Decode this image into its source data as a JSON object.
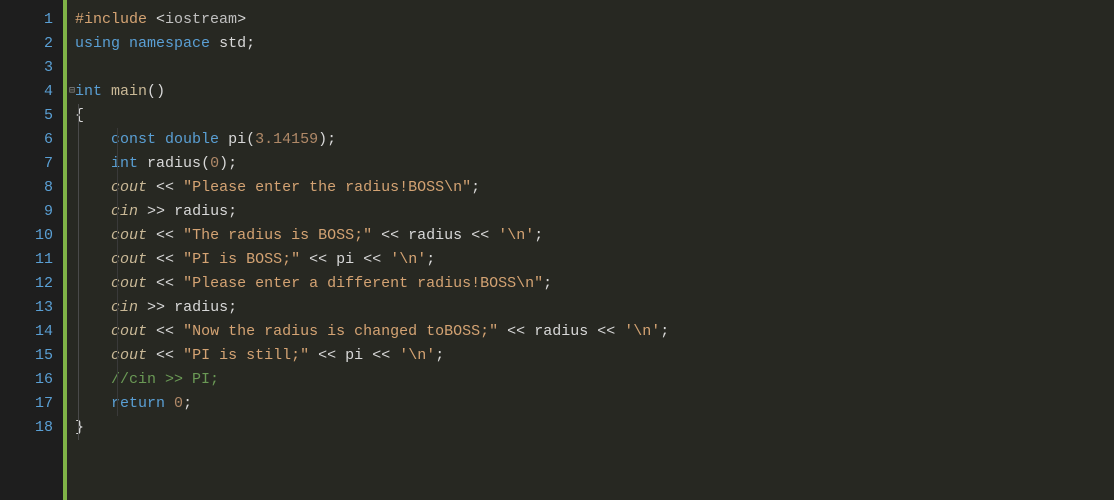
{
  "line_numbers": [
    "1",
    "2",
    "3",
    "4",
    "5",
    "6",
    "7",
    "8",
    "9",
    "10",
    "11",
    "12",
    "13",
    "14",
    "15",
    "16",
    "17",
    "18"
  ],
  "tokens": {
    "l1": {
      "include": "#include",
      "sp1": " ",
      "lt": "<",
      "hdr": "iostream",
      "gt": ">"
    },
    "l2": {
      "using": "using",
      "sp1": " ",
      "namespace": "namespace",
      "sp2": " ",
      "std": "std",
      "semi": ";"
    },
    "l4": {
      "int": "int",
      "sp1": " ",
      "main": "main",
      "lp": "(",
      "rp": ")"
    },
    "l5": {
      "indent": "",
      "brace": "{"
    },
    "l6": {
      "indent": "    ",
      "const": "const",
      "sp1": " ",
      "double": "double",
      "sp2": " ",
      "pi": "pi",
      "lp": "(",
      "val": "3.14159",
      "rp": ")",
      "semi": ";"
    },
    "l7": {
      "indent": "    ",
      "int": "int",
      "sp1": " ",
      "radius": "radius",
      "lp": "(",
      "zero": "0",
      "rp": ")",
      "semi": ";"
    },
    "l8": {
      "indent": "    ",
      "cout": "cout",
      "sp1": " ",
      "op1": "<<",
      "sp2": " ",
      "str": "\"Please enter the radius!BOSS\\n\"",
      "semi": ";"
    },
    "l9": {
      "indent": "    ",
      "cin": "cin",
      "sp1": " ",
      "op1": ">>",
      "sp2": " ",
      "radius": "radius",
      "semi": ";"
    },
    "l10": {
      "indent": "    ",
      "cout": "cout",
      "sp1": " ",
      "op1": "<<",
      "sp2": " ",
      "str": "\"The radius is BOSS;\"",
      "sp3": " ",
      "op2": "<<",
      "sp4": " ",
      "radius": "radius",
      "sp5": " ",
      "op3": "<<",
      "sp6": " ",
      "ch": "'\\n'",
      "semi": ";"
    },
    "l11": {
      "indent": "    ",
      "cout": "cout",
      "sp1": " ",
      "op1": "<<",
      "sp2": " ",
      "str": "\"PI is BOSS;\"",
      "sp3": " ",
      "op2": "<<",
      "sp4": " ",
      "pi": "pi",
      "sp5": " ",
      "op3": "<<",
      "sp6": " ",
      "ch": "'\\n'",
      "semi": ";"
    },
    "l12": {
      "indent": "    ",
      "cout": "cout",
      "sp1": " ",
      "op1": "<<",
      "sp2": " ",
      "str": "\"Please enter a different radius!BOSS\\n\"",
      "semi": ";"
    },
    "l13": {
      "indent": "    ",
      "cin": "cin",
      "sp1": " ",
      "op1": ">>",
      "sp2": " ",
      "radius": "radius",
      "semi": ";"
    },
    "l14": {
      "indent": "    ",
      "cout": "cout",
      "sp1": " ",
      "op1": "<<",
      "sp2": " ",
      "str": "\"Now the radius is changed toBOSS;\"",
      "sp3": " ",
      "op2": "<<",
      "sp4": " ",
      "radius": "radius",
      "sp5": " ",
      "op3": "<<",
      "sp6": " ",
      "ch": "'\\n'",
      "semi": ";"
    },
    "l15": {
      "indent": "    ",
      "cout": "cout",
      "sp1": " ",
      "op1": "<<",
      "sp2": " ",
      "str": "\"PI is still;\"",
      "sp3": " ",
      "op2": "<<",
      "sp4": " ",
      "pi": "pi",
      "sp5": " ",
      "op3": "<<",
      "sp6": " ",
      "ch": "'\\n'",
      "semi": ";"
    },
    "l16": {
      "indent": "    ",
      "comment": "//cin >> PI;"
    },
    "l17": {
      "indent": "    ",
      "return": "return",
      "sp1": " ",
      "zero": "0",
      "semi": ";"
    },
    "l18": {
      "indent": "",
      "brace": "}"
    }
  }
}
